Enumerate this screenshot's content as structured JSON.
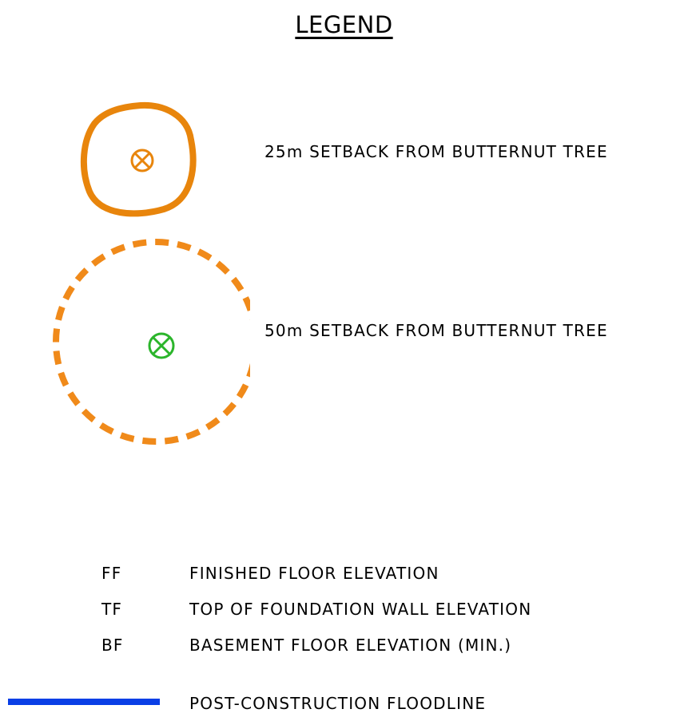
{
  "legend": {
    "title": "LEGEND",
    "colors": {
      "setback_25": "#E8850C",
      "setback_50": "#F08A1A",
      "tree_marker_50": "#2BB52B",
      "floodline": "#0A3FE6"
    },
    "symbols": [
      {
        "icon": "solid-orange-circle-with-tree-marker",
        "label": "25m SETBACK FROM BUTTERNUT TREE"
      },
      {
        "icon": "dashed-orange-circle-with-green-tree-marker",
        "label": "50m SETBACK FROM BUTTERNUT TREE"
      }
    ],
    "abbreviations": [
      {
        "code": "FF",
        "meaning": "FINISHED FLOOR ELEVATION"
      },
      {
        "code": "TF",
        "meaning": "TOP OF FOUNDATION WALL ELEVATION"
      },
      {
        "code": "BF",
        "meaning": "BASEMENT FLOOR ELEVATION (MIN.)"
      }
    ],
    "floodline": {
      "icon": "solid-blue-line",
      "label": "POST-CONSTRUCTION FLOODLINE"
    }
  }
}
